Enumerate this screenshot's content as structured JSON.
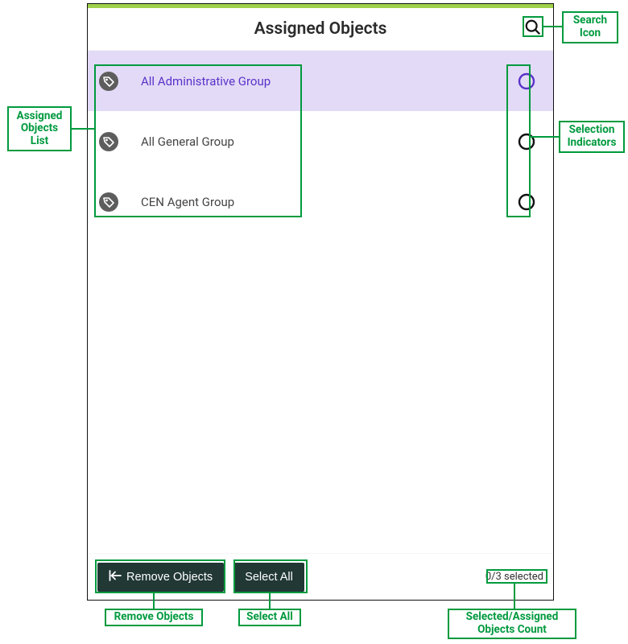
{
  "header": {
    "title": "Assigned Objects"
  },
  "list": {
    "items": [
      {
        "label": "All Administrative Group",
        "highlighted": true,
        "indicator_color": "#5a33c9"
      },
      {
        "label": "All General Group",
        "highlighted": false,
        "indicator_color": "#111111"
      },
      {
        "label": "CEN Agent Group",
        "highlighted": false,
        "indicator_color": "#111111"
      }
    ]
  },
  "footer": {
    "remove_label": "Remove Objects",
    "select_all_label": "Select All",
    "count_text": "0/3 selected"
  },
  "callouts": {
    "search_icon": "Search\nIcon",
    "assigned_list": "Assigned\nObjects\nList",
    "selection_indicators": "Selection\nIndicators",
    "remove_objects": "Remove Objects",
    "select_all": "Select All",
    "count": "Selected/Assigned\nObjects Count"
  }
}
